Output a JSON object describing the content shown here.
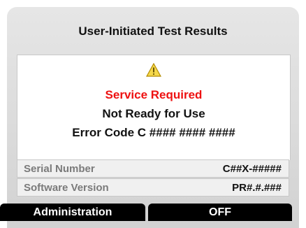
{
  "screen": {
    "title": "User-Initiated Test Results"
  },
  "message": {
    "icon": "warning-icon",
    "status": "Service Required",
    "readiness": "Not Ready for Use",
    "error_code": "Error Code C #### #### ####",
    "status_color": "#ee1111"
  },
  "info": {
    "serial_label": "Serial Number",
    "serial_value": "C##X-#####",
    "software_label": "Software Version",
    "software_value": "PR#.#.###"
  },
  "softkeys": {
    "left_label": "Administration",
    "right_label": "OFF"
  }
}
